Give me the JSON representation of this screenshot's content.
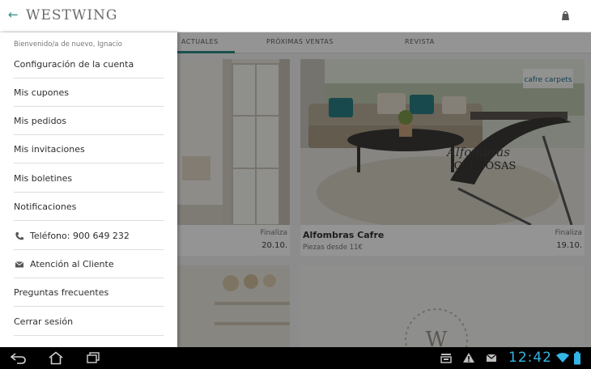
{
  "app": {
    "logo": "WESTWING",
    "back_icon": "arrow-left-icon",
    "bag_icon": "shopping-bag-icon",
    "accent_color": "#2f8d85"
  },
  "tabs": [
    {
      "label": "ACTUALES",
      "active": true
    },
    {
      "label": "PRÓXIMAS VENTAS",
      "active": false
    },
    {
      "label": "REVISTA",
      "active": false
    }
  ],
  "cards": [
    {
      "title": "",
      "subtitle": "",
      "end_label": "Finaliza",
      "end_date": "20.10."
    },
    {
      "title": "Alfombras Cafre",
      "subtitle": "Piezas desde 11€",
      "end_label": "Finaliza",
      "end_date": "19.10.",
      "brand_logo": "cafre carpets",
      "banner_line1": "Alfombras",
      "banner_line2": "GUSTOSAS"
    },
    {
      "title": "",
      "subtitle": "",
      "end_label": "",
      "end_date": ""
    },
    {
      "title": "",
      "subtitle": "",
      "end_label": "",
      "end_date": "",
      "logo_letter": "W"
    }
  ],
  "drawer": {
    "welcome": "Bienvenido/a de nuevo, Ignacio",
    "items": [
      {
        "label": "Configuración de la cuenta",
        "icon": ""
      },
      {
        "label": "Mis cupones",
        "icon": ""
      },
      {
        "label": "Mis pedidos",
        "icon": ""
      },
      {
        "label": "Mis invitaciones",
        "icon": ""
      },
      {
        "label": "Mis boletines",
        "icon": ""
      },
      {
        "label": "Notificaciones",
        "icon": ""
      },
      {
        "label": "Teléfono: 900 649 232",
        "icon": "phone-icon"
      },
      {
        "label": "Atención al Cliente",
        "icon": "mail-icon"
      },
      {
        "label": "Preguntas frecuentes",
        "icon": ""
      },
      {
        "label": "Cerrar sesión",
        "icon": ""
      }
    ]
  },
  "system_bar": {
    "clock": "12:42",
    "clock_color": "#33b5e5"
  }
}
